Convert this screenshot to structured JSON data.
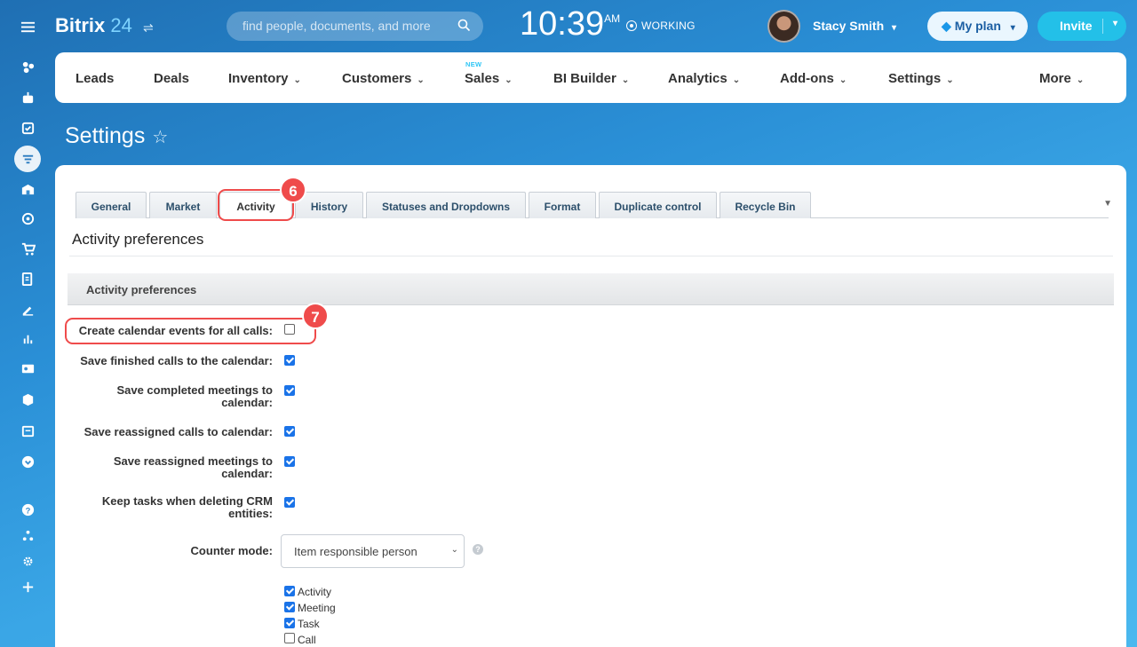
{
  "header": {
    "logo_main": "Bitrix",
    "logo_num": "24",
    "search_placeholder": "find people, documents, and more",
    "time": "10:39",
    "ampm": "AM",
    "status": "WORKING",
    "user_name": "Stacy Smith",
    "plan_label": "My plan",
    "invite_label": "Invite"
  },
  "sidebar": {
    "icons": [
      "menu-icon",
      "feed-icon",
      "robot-icon",
      "tasks-icon",
      "crm-filter-icon",
      "store-icon",
      "target-icon",
      "cart-icon",
      "docs-icon",
      "sign-icon",
      "analytics-icon",
      "contact-card-icon",
      "box-icon",
      "calendar-list-icon",
      "more-down-icon",
      "help-icon",
      "sitemap-icon",
      "settings-gear-icon",
      "plus-icon"
    ]
  },
  "topnav": {
    "items": [
      "Leads",
      "Deals",
      "Inventory",
      "Customers",
      "Sales",
      "BI Builder",
      "Analytics",
      "Add-ons",
      "Settings",
      "More"
    ],
    "new_badge": "NEW"
  },
  "page": {
    "title": "Settings"
  },
  "tabs": [
    "General",
    "Market",
    "Activity",
    "History",
    "Statuses and Dropdowns",
    "Format",
    "Duplicate control",
    "Recycle Bin"
  ],
  "callouts": {
    "tab_badge": "6",
    "row_badge": "7",
    "highlight_color": "#ef4b4b"
  },
  "section": {
    "title": "Activity preferences",
    "bar_title": "Activity preferences"
  },
  "options": [
    {
      "label": "Create calendar events for all calls:",
      "checked": false
    },
    {
      "label": "Save finished calls to the calendar:",
      "checked": true
    },
    {
      "label": "Save completed meetings to calendar:",
      "checked": true
    },
    {
      "label": "Save reassigned calls to calendar:",
      "checked": true
    },
    {
      "label": "Save reassigned meetings to calendar:",
      "checked": true
    },
    {
      "label": "Keep tasks when deleting CRM entities:",
      "checked": true
    }
  ],
  "counter": {
    "label": "Counter mode:",
    "selected": "Item responsible person",
    "help": "?",
    "types": [
      {
        "label": "Activity",
        "checked": true
      },
      {
        "label": "Meeting",
        "checked": true
      },
      {
        "label": "Task",
        "checked": true
      },
      {
        "label": "Call",
        "checked": false
      }
    ]
  },
  "colors": {
    "accent": "#1a73e8",
    "invite": "#23c0e8",
    "new_badge": "#2fc6f6"
  }
}
